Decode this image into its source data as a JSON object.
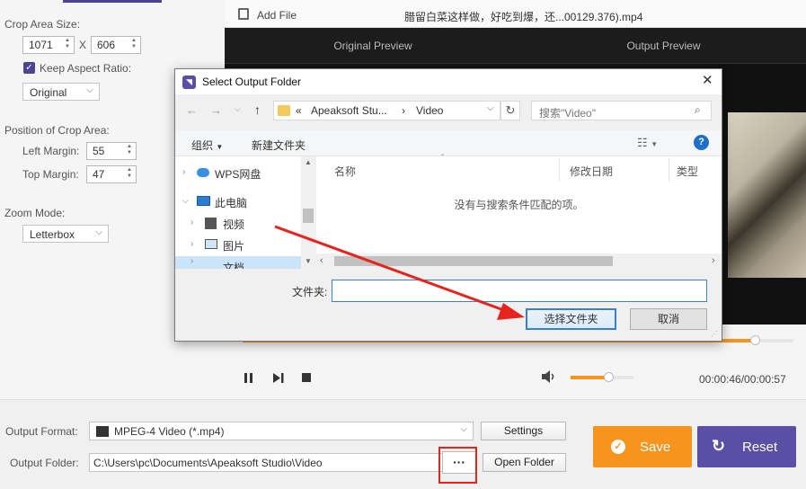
{
  "left": {
    "crop_area_label": "Crop Area Size:",
    "width": "1071",
    "x_sep": "X",
    "height": "606",
    "keep_aspect_label": "Keep Aspect Ratio:",
    "aspect_value": "Original",
    "position_label": "Position of Crop Area:",
    "left_margin_label": "Left Margin:",
    "left_margin": "55",
    "top_margin_label": "Top Margin:",
    "top_margin": "47",
    "zoom_label": "Zoom Mode:",
    "zoom_value": "Letterbox"
  },
  "toolbar": {
    "add_file": "Add File",
    "file_name": "腊留白菜这样做，好吃到爆，还...00129.376).mp4"
  },
  "preview": {
    "original": "Original Preview",
    "output": "Output Preview"
  },
  "player": {
    "time": "00:00:46/00:00:57",
    "progress": 0.93,
    "volume": 0.6
  },
  "dialog": {
    "title": "Select Output Folder",
    "path_prefix": "«",
    "path_1": "Apeaksoft Stu...",
    "path_sep": "›",
    "path_2": "Video",
    "search_placeholder": "搜索\"Video\"",
    "organize": "组织",
    "new_folder": "新建文件夹",
    "col_name": "名称",
    "col_date": "修改日期",
    "col_type": "类型",
    "empty": "没有与搜索条件匹配的项。",
    "tree": [
      "WPS网盘",
      "此电脑",
      "视频",
      "图片",
      "文档"
    ],
    "folder_label": "文件夹:",
    "folder_value": "",
    "select_btn": "选择文件夹",
    "cancel_btn": "取消"
  },
  "bottom": {
    "format_label": "Output Format:",
    "format_value": "MPEG-4 Video (*.mp4)",
    "settings_btn": "Settings",
    "folder_label": "Output Folder:",
    "folder_value": "C:\\Users\\pc\\Documents\\Apeaksoft Studio\\Video",
    "dots_btn": "···",
    "open_folder_btn": "Open Folder",
    "save_btn": "Save",
    "reset_btn": "Reset"
  },
  "colors": {
    "accent_orange": "#f7941d",
    "accent_purple": "#5a4ea6",
    "annotation_red": "#e8231c",
    "highlight_blue": "#3a7fd6"
  }
}
